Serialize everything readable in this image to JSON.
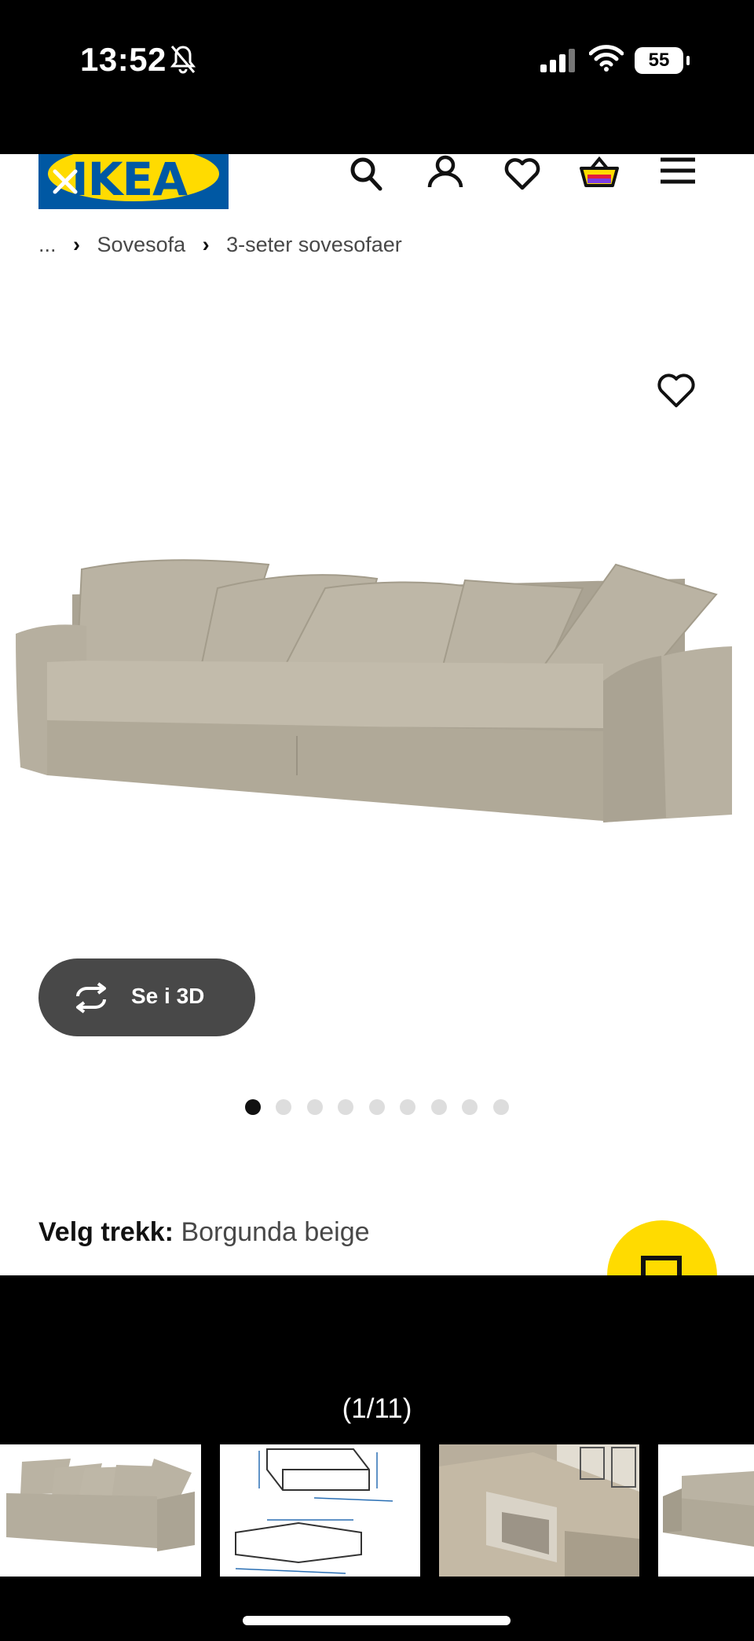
{
  "status_bar": {
    "time": "13:52",
    "battery": "55"
  },
  "header": {
    "logo_text": "IKEA"
  },
  "breadcrumb": [
    "...",
    "Sovesofa",
    "3-seter sovesofaer"
  ],
  "product": {
    "view_3d_label": "Se i 3D",
    "image_count": 9,
    "active_image": 1,
    "variant_label": "Velg trekk:",
    "variant_value": "Borgunda beige"
  },
  "gallery": {
    "counter": "(1/11)"
  },
  "colors": {
    "ikea_blue": "#0058a3",
    "ikea_yellow": "#ffdb00",
    "fabric": "#b9b2a3"
  },
  "icons": [
    "silent-bell-icon",
    "signal-icon",
    "wifi-icon",
    "close-icon",
    "search-icon",
    "account-icon",
    "heart-icon",
    "cart-icon",
    "menu-icon",
    "rotate-3d-icon"
  ]
}
